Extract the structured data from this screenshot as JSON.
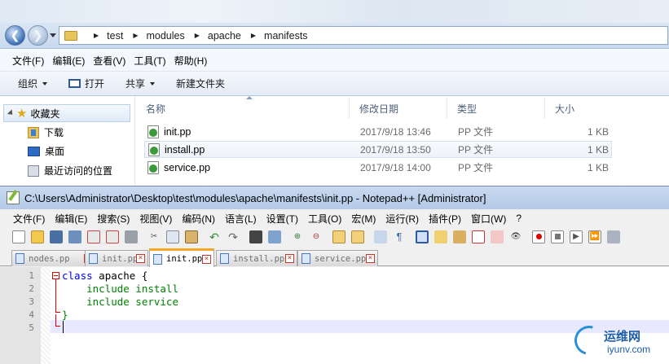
{
  "explorer": {
    "breadcrumb": [
      "test",
      "modules",
      "apache",
      "manifests"
    ],
    "menu": [
      "文件(F)",
      "编辑(E)",
      "查看(V)",
      "工具(T)",
      "帮助(H)"
    ],
    "commands": {
      "organize": "组织",
      "open": "打开",
      "share": "共享",
      "new_folder": "新建文件夹"
    },
    "nav": {
      "favorites": "收藏夹",
      "downloads": "下载",
      "desktop": "桌面",
      "recent": "最近访问的位置"
    },
    "columns": {
      "name": "名称",
      "modified": "修改日期",
      "type": "类型",
      "size": "大小"
    },
    "files": [
      {
        "name": "init.pp",
        "modified": "2017/9/18 13:46",
        "type": "PP 文件",
        "size": "1 KB"
      },
      {
        "name": "install.pp",
        "modified": "2017/9/18 13:50",
        "type": "PP 文件",
        "size": "1 KB"
      },
      {
        "name": "service.pp",
        "modified": "2017/9/18 14:00",
        "type": "PP 文件",
        "size": "1 KB"
      }
    ]
  },
  "notepad": {
    "title": "C:\\Users\\Administrator\\Desktop\\test\\modules\\apache\\manifests\\init.pp - Notepad++ [Administrator]",
    "menu": [
      "文件(F)",
      "编辑(E)",
      "搜索(S)",
      "视图(V)",
      "编码(N)",
      "语言(L)",
      "设置(T)",
      "工具(O)",
      "宏(M)",
      "运行(R)",
      "插件(P)",
      "窗口(W)",
      "?"
    ],
    "tabs": [
      {
        "label": "nodes.pp"
      },
      {
        "label": "init.pp"
      },
      {
        "label": "init.pp"
      },
      {
        "label": "install.pp"
      },
      {
        "label": "service.pp"
      }
    ],
    "line_numbers": [
      "1",
      "2",
      "3",
      "4",
      "5"
    ],
    "code": {
      "l1_kw": "class",
      "l1_rest": " apache {",
      "l2": "    include install",
      "l3": "    include service",
      "l4": "}"
    }
  },
  "watermark": {
    "line1": "运维网",
    "line2": "iyunv.com"
  },
  "colors": {
    "accent_tab": "#f5a623",
    "keyword": "#0000ff",
    "include": "#008000",
    "brace": "#008000"
  }
}
